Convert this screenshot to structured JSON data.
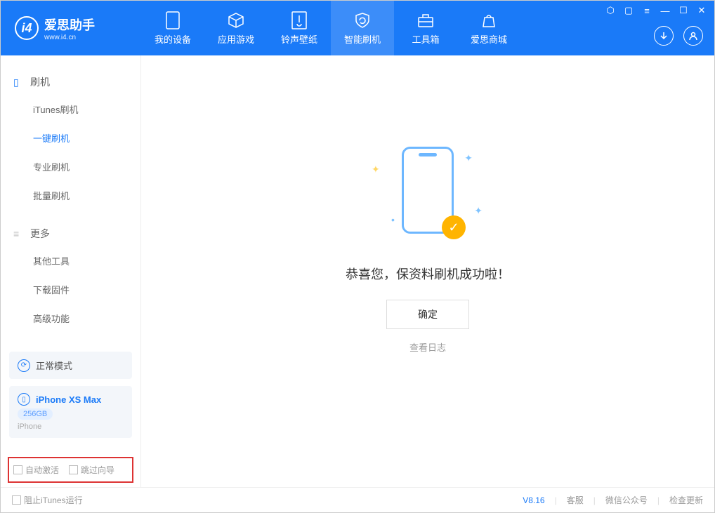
{
  "logo": {
    "main": "爱思助手",
    "sub": "www.i4.cn"
  },
  "nav": {
    "items": [
      {
        "label": "我的设备"
      },
      {
        "label": "应用游戏"
      },
      {
        "label": "铃声壁纸"
      },
      {
        "label": "智能刷机"
      },
      {
        "label": "工具箱"
      },
      {
        "label": "爱思商城"
      }
    ]
  },
  "sidebar": {
    "section1": {
      "title": "刷机",
      "items": [
        "iTunes刷机",
        "一键刷机",
        "专业刷机",
        "批量刷机"
      ]
    },
    "section2": {
      "title": "更多",
      "items": [
        "其他工具",
        "下载固件",
        "高级功能"
      ]
    },
    "mode": "正常模式",
    "device": {
      "name": "iPhone XS Max",
      "capacity": "256GB",
      "type": "iPhone"
    },
    "checks": {
      "auto_activate": "自动激活",
      "skip_guide": "跳过向导"
    }
  },
  "main": {
    "success": "恭喜您，保资料刷机成功啦！",
    "ok": "确定",
    "view_log": "查看日志"
  },
  "footer": {
    "block_itunes": "阻止iTunes运行",
    "version": "V8.16",
    "links": [
      "客服",
      "微信公众号",
      "检查更新"
    ]
  }
}
